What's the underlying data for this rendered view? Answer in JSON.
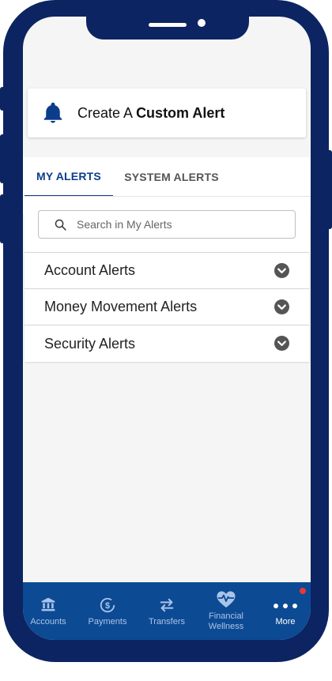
{
  "colors": {
    "frame": "#0c2461",
    "accent": "#0b3d8a",
    "nav_bg": "#0d4a94",
    "notification": "#e53935"
  },
  "create_alert": {
    "prefix": "Create A",
    "bold": "Custom Alert",
    "icon": "bell-icon"
  },
  "tabs": [
    {
      "label": "MY ALERTS",
      "active": true
    },
    {
      "label": "SYSTEM ALERTS",
      "active": false
    }
  ],
  "search": {
    "placeholder": "Search in My Alerts",
    "value": "",
    "icon": "search-icon"
  },
  "alert_groups": [
    {
      "label": "Account Alerts",
      "icon": "chevron-down-icon"
    },
    {
      "label": "Money Movement Alerts",
      "icon": "chevron-down-icon"
    },
    {
      "label": "Security Alerts",
      "icon": "chevron-down-icon"
    }
  ],
  "bottom_nav": [
    {
      "label": "Accounts",
      "icon": "bank-icon",
      "active": false
    },
    {
      "label": "Payments",
      "icon": "dollar-cycle-icon",
      "active": false
    },
    {
      "label": "Transfers",
      "icon": "transfer-arrows-icon",
      "active": false
    },
    {
      "label": "Financial Wellness",
      "icon": "heart-pulse-icon",
      "active": false
    },
    {
      "label": "More",
      "icon": "more-dots-icon",
      "active": true,
      "has_notification": true
    }
  ]
}
